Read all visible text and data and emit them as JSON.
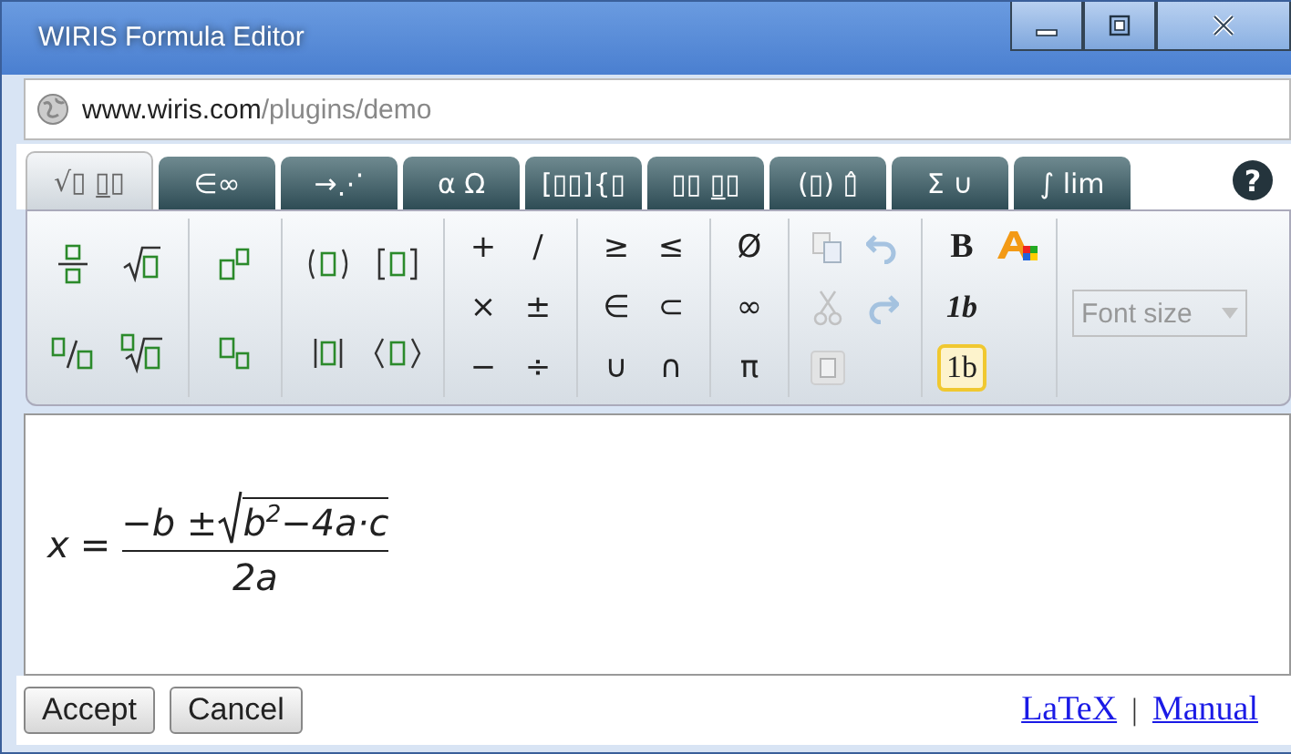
{
  "window": {
    "title": "WIRIS Formula Editor"
  },
  "address": {
    "host": "www.wiris.com",
    "path": "/plugins/demo"
  },
  "tabs": [
    {
      "label": "√▯ ▯̲▯",
      "selected": true
    },
    {
      "label": "∈∞",
      "selected": false
    },
    {
      "label": "→⋰",
      "selected": false
    },
    {
      "label": "α Ω",
      "selected": false
    },
    {
      "label": "[▯▯]{▯",
      "selected": false
    },
    {
      "label": "▯▯ ▯̲▯",
      "selected": false
    },
    {
      "label": "(▯) ▯̂",
      "selected": false
    },
    {
      "label": "Σ ∪",
      "selected": false
    },
    {
      "label": "∫ lim",
      "selected": false
    }
  ],
  "help": "?",
  "toolbar": [
    {
      "items": [
        {
          "kind": "fraction"
        },
        {
          "kind": "root"
        },
        {
          "kind": "bevelled-fraction"
        },
        {
          "kind": "nth-root"
        }
      ]
    },
    {
      "items": [
        {
          "kind": "superscript"
        },
        {
          "kind": "subscript"
        }
      ]
    },
    {
      "items": [
        {
          "kind": "parentheses"
        },
        {
          "kind": "brackets"
        },
        {
          "kind": "absolute-value"
        },
        {
          "kind": "angle-brackets"
        }
      ]
    },
    {
      "items": [
        {
          "kind": "text",
          "label": "+"
        },
        {
          "kind": "text",
          "label": "/"
        },
        {
          "kind": "text",
          "label": "×"
        },
        {
          "kind": "text",
          "label": "±"
        },
        {
          "kind": "text",
          "label": "−"
        },
        {
          "kind": "text",
          "label": "÷"
        }
      ]
    },
    {
      "items": [
        {
          "kind": "text",
          "label": "≥"
        },
        {
          "kind": "text",
          "label": "≤"
        },
        {
          "kind": "text",
          "label": "∈"
        },
        {
          "kind": "text",
          "label": "⊂"
        },
        {
          "kind": "text",
          "label": "∪"
        },
        {
          "kind": "text",
          "label": "∩"
        }
      ]
    },
    {
      "items": [
        {
          "kind": "text",
          "label": "Ø"
        },
        {
          "kind": "text",
          "label": "∞"
        },
        {
          "kind": "text",
          "label": "π"
        }
      ]
    },
    {
      "items": [
        {
          "kind": "copy",
          "disabled": true
        },
        {
          "kind": "undo",
          "disabled": true
        },
        {
          "kind": "cut",
          "disabled": true
        },
        {
          "kind": "redo",
          "disabled": true
        },
        {
          "kind": "paste",
          "disabled": true
        }
      ]
    },
    {
      "items": [
        {
          "kind": "bold",
          "label": "B"
        },
        {
          "kind": "font-color"
        },
        {
          "kind": "text",
          "label": "1b",
          "italic": true,
          "selected": false
        },
        {
          "kind": "spacer"
        },
        {
          "kind": "text",
          "label": "1b",
          "italic": false,
          "selected": true
        }
      ]
    }
  ],
  "font_size": {
    "placeholder": "Font size",
    "disabled": true
  },
  "formula": {
    "lhs": "x",
    "op": "=",
    "numerator": "−b ±",
    "radicand": "b$^{2}$−4a·c",
    "denominator": "2a"
  },
  "buttons": [
    "Accept",
    "Cancel"
  ],
  "links": [
    "LaTeX",
    "Manual"
  ],
  "link_separator": "|"
}
